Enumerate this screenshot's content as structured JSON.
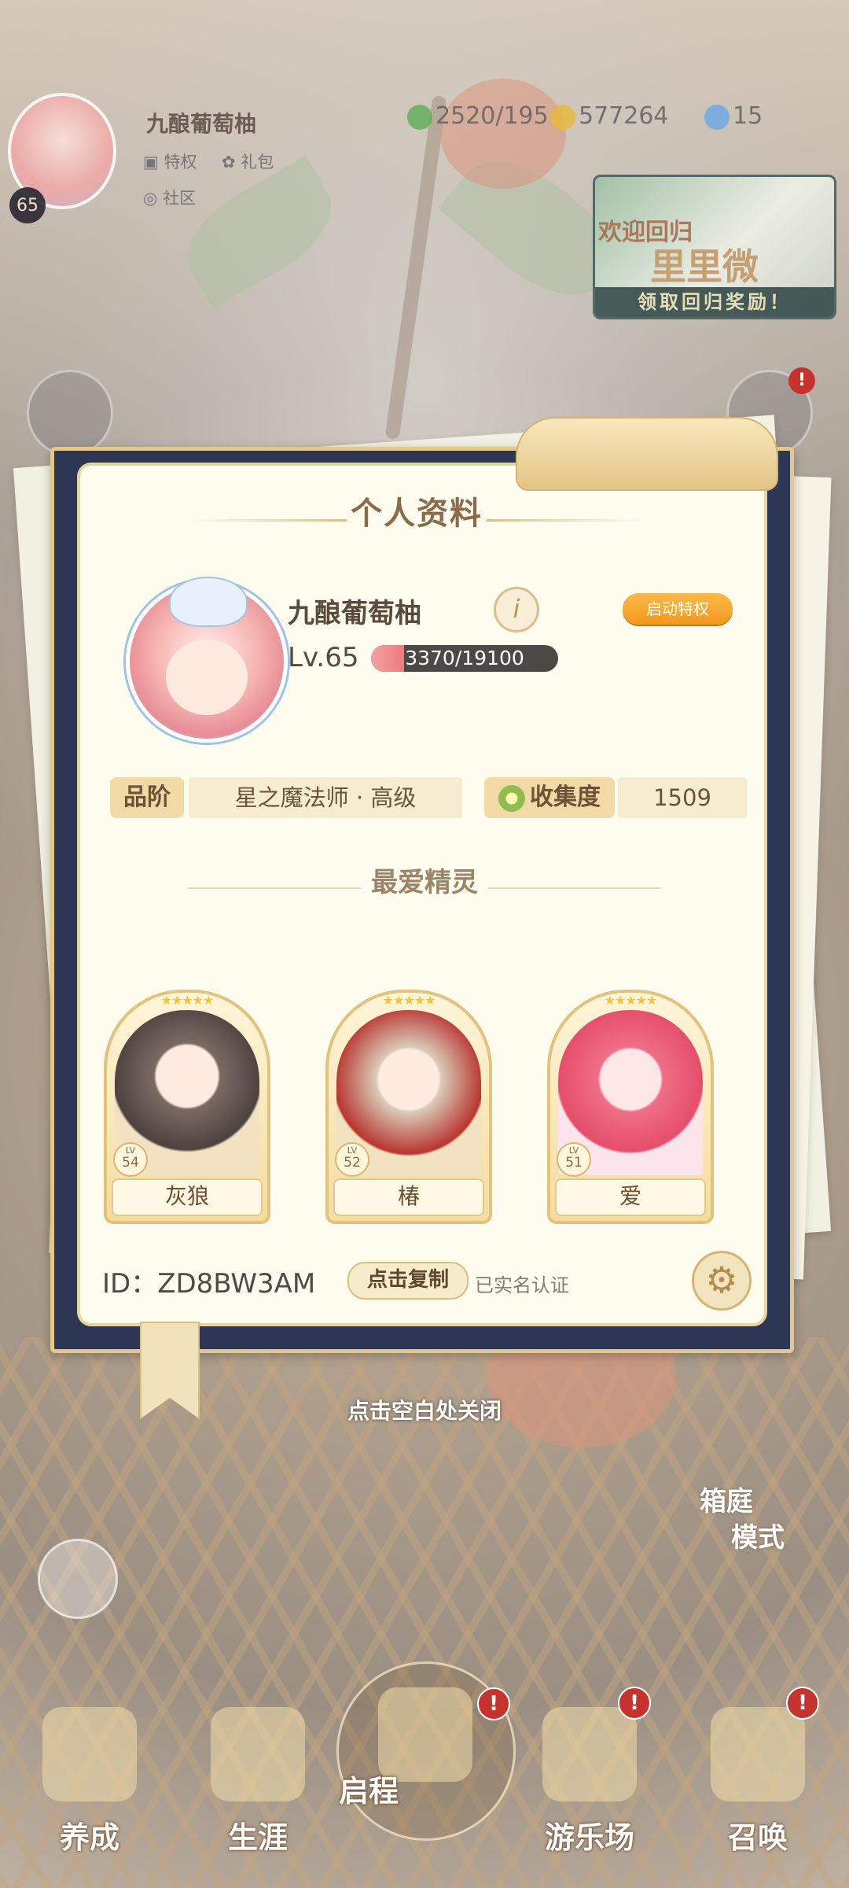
{
  "hud": {
    "player_name": "九酿葡萄柚",
    "level": "65",
    "links": [
      "特权",
      "礼包",
      "社区"
    ],
    "resources": [
      {
        "name": "clover-energy",
        "value": "2520/195",
        "color": "#5fae56"
      },
      {
        "name": "gold-coin",
        "value": "577264",
        "color": "#e9b93a"
      },
      {
        "name": "crystal",
        "value": "15",
        "color": "#69a8e6"
      }
    ],
    "banner": {
      "line1": "欢迎回归",
      "line2": "里里微",
      "cta": "领取回归奖励！"
    }
  },
  "profile": {
    "title": "个人资料",
    "name": "九酿葡萄柚",
    "info_icon": "i",
    "privilege_button": "启动特权",
    "level_label": "Lv.65",
    "xp_text": "3370/19100",
    "xp_current": 3370,
    "xp_max": 19100,
    "rank_label": "品阶",
    "rank_value": "星之魔法师 · 高级",
    "collection_label": "收集度",
    "collection_value": "1509",
    "favorites_title": "最爱精灵",
    "spirits": [
      {
        "name": "灰狼",
        "lv_label": "LV",
        "level": "54",
        "stars": "★★★★★",
        "color": "#7b6a63"
      },
      {
        "name": "椿",
        "lv_label": "LV",
        "level": "52",
        "stars": "★★★★★",
        "color": "#b8352f"
      },
      {
        "name": "爱",
        "lv_label": "LV",
        "level": "51",
        "stars": "★★★★★",
        "color": "#ef6f86"
      }
    ],
    "id_text": "ID：ZD8BW3AM",
    "copy_button": "点击复制",
    "verified": "已实名认证"
  },
  "close_hint": "点击空白处关闭",
  "yard_mode": {
    "line1": "箱庭",
    "line2": "模式"
  },
  "nav": [
    {
      "label": "养成",
      "badge": false
    },
    {
      "label": "生涯",
      "badge": false
    },
    {
      "label": "启程",
      "badge": true
    },
    {
      "label": "游乐场",
      "badge": true
    },
    {
      "label": "召唤",
      "badge": true
    }
  ],
  "badge_text": "!"
}
